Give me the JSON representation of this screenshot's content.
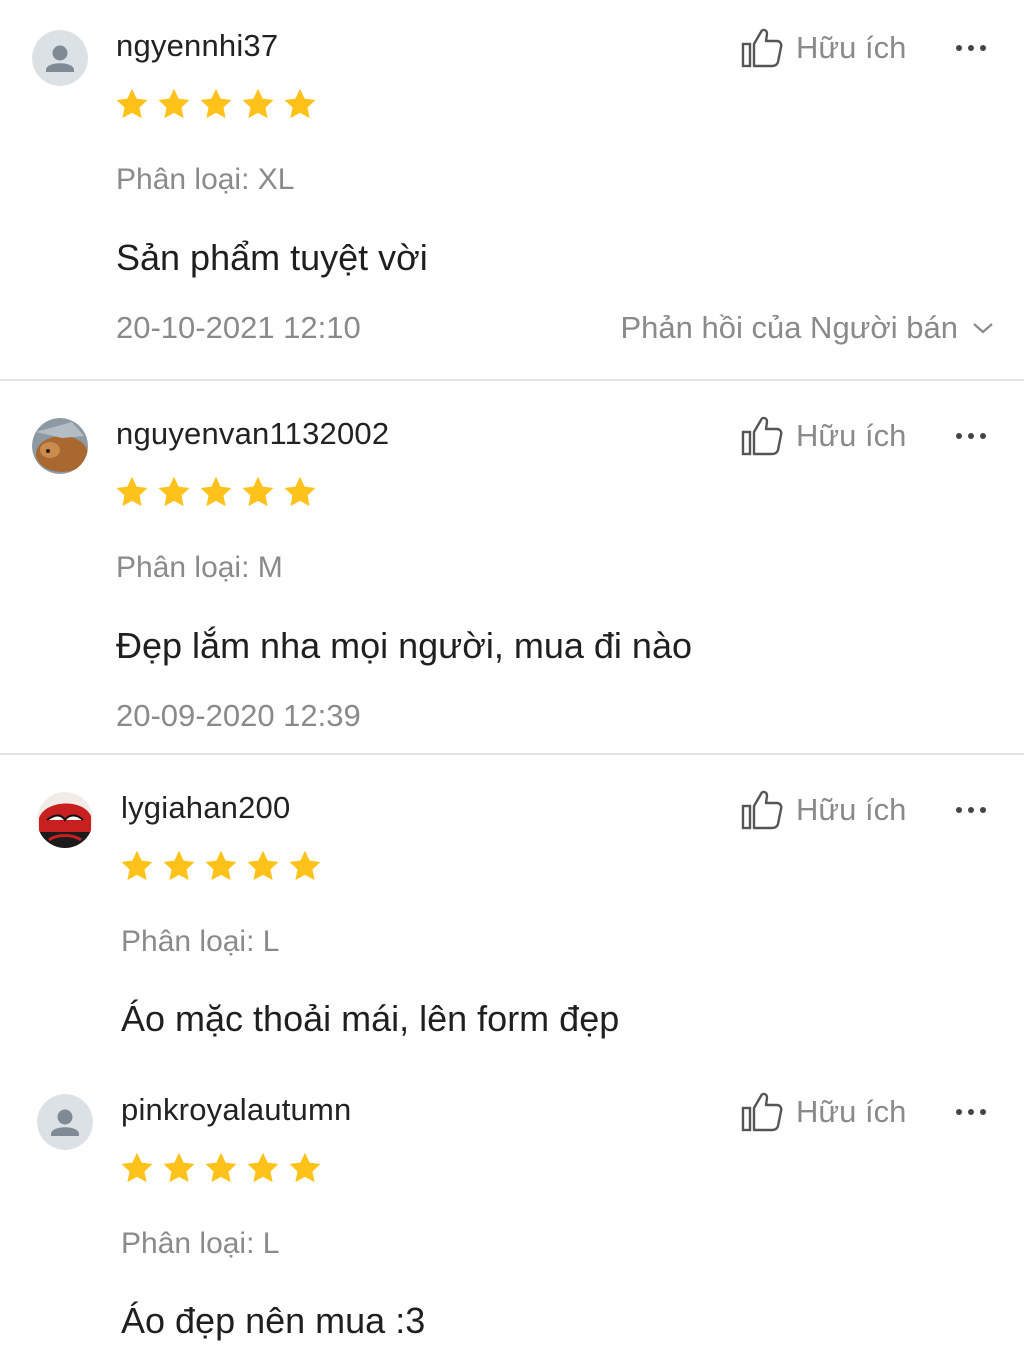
{
  "reviews": [
    {
      "username": "ngyennhi37",
      "rating": 5,
      "variation": "Phân loại: XL",
      "comment": "Sản phẩm tuyệt vời",
      "date": "20-10-2021 12:10",
      "seller_reply": "Phản hồi của Người bán",
      "helpful": "Hữu ích",
      "avatar": "default-user-icon"
    },
    {
      "username": "nguyenvan1132002",
      "rating": 5,
      "variation": "Phân loại: M",
      "comment": "Đẹp lắm nha mọi người, mua đi nào",
      "date": "20-09-2020 12:39",
      "helpful": "Hữu ích",
      "avatar": "photo-avatar"
    },
    {
      "username": "lygiahan200",
      "rating": 5,
      "variation": "Phân loại: L",
      "comment": "Áo mặc thoải mái, lên form đẹp",
      "helpful": "Hữu ích",
      "avatar": "photo-avatar"
    },
    {
      "username": "pinkroyalautumn",
      "rating": 5,
      "variation": "Phân loại: L",
      "comment": "Áo đẹp nên mua :3",
      "helpful": "Hữu ích",
      "avatar": "default-user-icon"
    }
  ],
  "colors": {
    "star": "#FFC21A",
    "muted_text": "#8A8A8A",
    "divider": "#E4E4E4",
    "avatar_bg": "#DCE1E6",
    "avatar_icon": "#7F8A95"
  }
}
